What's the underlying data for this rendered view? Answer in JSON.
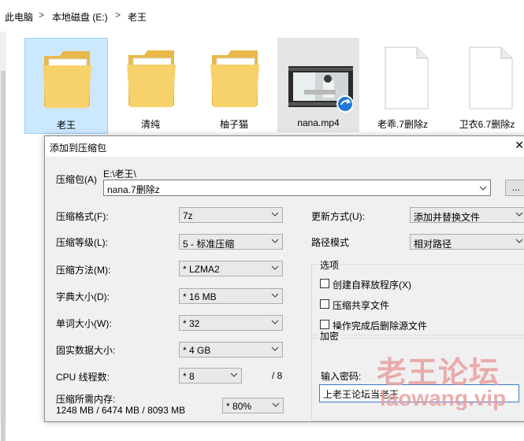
{
  "breadcrumb": {
    "items": [
      "此电脑",
      "本地磁盘 (E:)",
      "老王"
    ],
    "sep": ">"
  },
  "files": [
    {
      "name": "老王",
      "kind": "folder",
      "state": "selected"
    },
    {
      "name": "清纯",
      "kind": "folder",
      "state": "normal"
    },
    {
      "name": "柚子猫",
      "kind": "folder",
      "state": "normal"
    },
    {
      "name": "nana.mp4",
      "kind": "video",
      "state": "hover"
    },
    {
      "name": "老乖.7删除z",
      "kind": "document",
      "state": "normal"
    },
    {
      "name": "卫衣6.7删除z",
      "kind": "document",
      "state": "normal"
    }
  ],
  "dialog": {
    "title": "添加到压缩包",
    "archive_label": "压缩包(A)",
    "archive_path": "E:\\老王\\",
    "archive_name": "nana.7删除z",
    "browse_label": "...",
    "left": {
      "format_label": "压缩格式(F):",
      "format_value": "7z",
      "level_label": "压缩等级(L):",
      "level_value": "5 - 标准压缩",
      "method_label": "压缩方法(M):",
      "method_value": "*  LZMA2",
      "dict_label": "字典大小(D):",
      "dict_value": "*  16 MB",
      "word_label": "单词大小(W):",
      "word_value": "*  32",
      "solid_label": "固实数据大小:",
      "solid_value": "*  4 GB",
      "threads_label": "CPU 线程数:",
      "threads_value": "*  8",
      "threads_total": "/ 8",
      "memory_label": "压缩所需内存:",
      "memory_value": "1248 MB / 6474 MB / 8093 MB",
      "memory_percent": "* 80%"
    },
    "right": {
      "update_label": "更新方式(U):",
      "update_value": "添加并替换文件",
      "path_label": "路径模式",
      "path_value": "相对路径",
      "options_title": "选项",
      "options": [
        "创建自释放程序(X)",
        "压缩共享文件",
        "操作完成后删除源文件"
      ],
      "encrypt_title": "加密",
      "password_label": "输入密码:",
      "password_value": "上老王论坛当老王"
    }
  },
  "watermark": {
    "cn": "老王论坛",
    "en": "laowang.vip"
  },
  "colors": {
    "selected_bg": "#cce8ff",
    "folder": "#f7d26a",
    "watermark": "#e8a0a0"
  }
}
